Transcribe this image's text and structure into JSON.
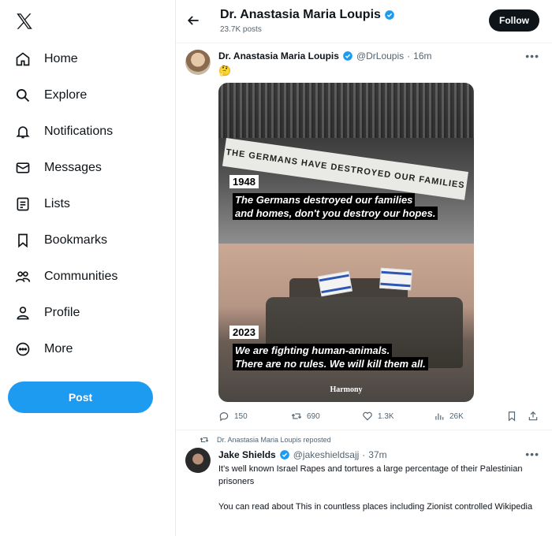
{
  "sidebar": {
    "items": [
      {
        "label": "Home",
        "icon": "home-icon"
      },
      {
        "label": "Explore",
        "icon": "search-icon"
      },
      {
        "label": "Notifications",
        "icon": "bell-icon"
      },
      {
        "label": "Messages",
        "icon": "mail-icon"
      },
      {
        "label": "Lists",
        "icon": "list-icon"
      },
      {
        "label": "Bookmarks",
        "icon": "bookmark-icon"
      },
      {
        "label": "Communities",
        "icon": "communities-icon"
      },
      {
        "label": "Profile",
        "icon": "profile-icon"
      },
      {
        "label": "More",
        "icon": "more-circle-icon"
      }
    ],
    "post_label": "Post"
  },
  "header": {
    "name": "Dr. Anastasia Maria Loupis",
    "posts": "23.7K posts",
    "follow_label": "Follow"
  },
  "tweet": {
    "name": "Dr. Anastasia Maria Loupis",
    "handle": "@DrLoupis",
    "time": "16m",
    "emoji": "🤔",
    "media": {
      "banner_text": "THE GERMANS HAVE DESTROYED OUR FAMILIES",
      "year_top": "1948",
      "caption_top": [
        "The Germans destroyed our families",
        "and homes, don't you destroy our hopes."
      ],
      "year_bottom": "2023",
      "caption_bottom": [
        "We are fighting human-animals.",
        "There are no rules. We will kill them all."
      ],
      "watermark": "Harmony"
    },
    "replies": "150",
    "reposts": "690",
    "likes": "1.3K",
    "views": "26K"
  },
  "repost": {
    "reposter": "Dr. Anastasia Maria Loupis reposted",
    "name": "Jake Shields",
    "handle": "@jakeshieldsajj",
    "time": "37m",
    "text_1": "It's well known Israel Rapes and tortures a large percentage of their Palestinian prisoners",
    "text_2": "You can read about This in countless places including Zionist controlled Wikipedia"
  }
}
